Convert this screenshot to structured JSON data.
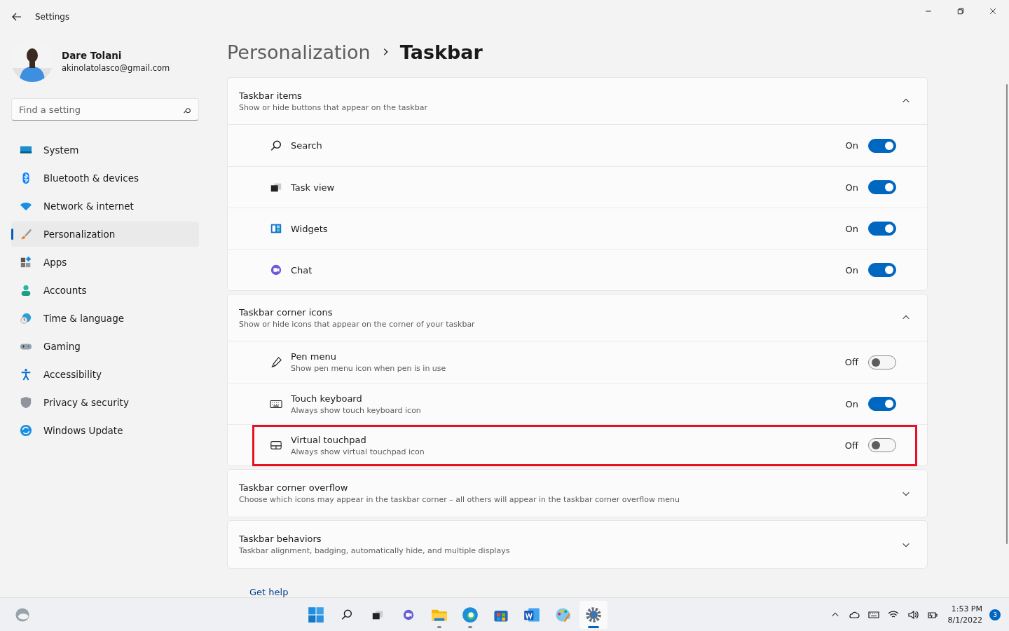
{
  "window": {
    "title": "Settings"
  },
  "profile": {
    "name": "Dare Tolani",
    "email": "akinolatolasco@gmail.com"
  },
  "search": {
    "placeholder": "Find a setting"
  },
  "nav": [
    {
      "label": "System",
      "selected": false
    },
    {
      "label": "Bluetooth & devices",
      "selected": false
    },
    {
      "label": "Network & internet",
      "selected": false
    },
    {
      "label": "Personalization",
      "selected": true
    },
    {
      "label": "Apps",
      "selected": false
    },
    {
      "label": "Accounts",
      "selected": false
    },
    {
      "label": "Time & language",
      "selected": false
    },
    {
      "label": "Gaming",
      "selected": false
    },
    {
      "label": "Accessibility",
      "selected": false
    },
    {
      "label": "Privacy & security",
      "selected": false
    },
    {
      "label": "Windows Update",
      "selected": false
    }
  ],
  "breadcrumb": [
    "Personalization",
    "Taskbar"
  ],
  "sections": [
    {
      "title": "Taskbar items",
      "description": "Show or hide buttons that appear on the taskbar",
      "expanded": true,
      "rows": [
        {
          "label": "Search",
          "state": "On",
          "on": true,
          "highlighted": false
        },
        {
          "label": "Task view",
          "state": "On",
          "on": true,
          "highlighted": false
        },
        {
          "label": "Widgets",
          "state": "On",
          "on": true,
          "highlighted": false
        },
        {
          "label": "Chat",
          "state": "On",
          "on": true,
          "highlighted": false
        }
      ]
    },
    {
      "title": "Taskbar corner icons",
      "description": "Show or hide icons that appear on the corner of your taskbar",
      "expanded": true,
      "rows": [
        {
          "label": "Pen menu",
          "description": "Show pen menu icon when pen is in use",
          "state": "Off",
          "on": false,
          "highlighted": false
        },
        {
          "label": "Touch keyboard",
          "description": "Always show touch keyboard icon",
          "state": "On",
          "on": true,
          "highlighted": false
        },
        {
          "label": "Virtual touchpad",
          "description": "Always show virtual touchpad icon",
          "state": "Off",
          "on": false,
          "highlighted": true
        }
      ]
    },
    {
      "title": "Taskbar corner overflow",
      "description": "Choose which icons may appear in the taskbar corner – all others will appear in the taskbar corner overflow menu",
      "expanded": false
    },
    {
      "title": "Taskbar behaviors",
      "description": "Taskbar alignment, badging, automatically hide, and multiple displays",
      "expanded": false
    }
  ],
  "help_link": "Get help",
  "taskbar": {
    "apps": [
      {
        "running": false,
        "active": false
      },
      {
        "running": false,
        "active": false
      },
      {
        "running": false,
        "active": false
      },
      {
        "running": false,
        "active": false
      },
      {
        "running": true,
        "active": false
      },
      {
        "running": true,
        "active": false
      },
      {
        "running": false,
        "active": false
      },
      {
        "running": false,
        "active": false
      },
      {
        "running": false,
        "active": false
      },
      {
        "running": true,
        "active": true
      }
    ],
    "time": "1:53 PM",
    "date": "8/1/2022",
    "notifications": "3"
  }
}
